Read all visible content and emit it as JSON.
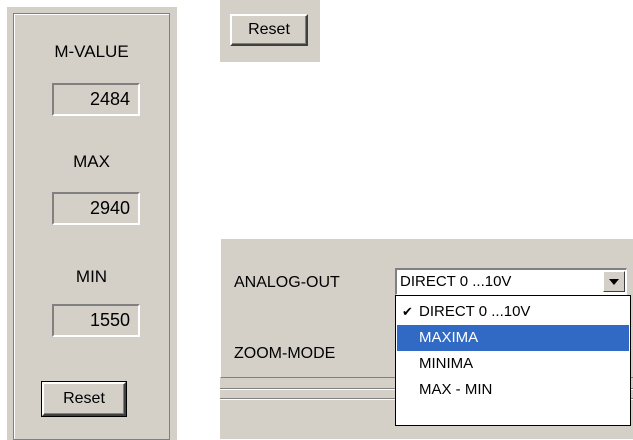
{
  "left_panel": {
    "mvalue_label": "M-VALUE",
    "mvalue": "2484",
    "max_label": "MAX",
    "max_value": "2940",
    "min_label": "MIN",
    "min_value": "1550",
    "reset_label": "Reset"
  },
  "top_panel": {
    "reset_label": "Reset"
  },
  "settings": {
    "analog_out_label": "ANALOG-OUT",
    "analog_out_value": "DIRECT 0 ...10V",
    "zoom_mode_label": "ZOOM-MODE"
  },
  "dropdown": {
    "options": [
      {
        "label": "DIRECT 0 ...10V",
        "checked": true
      },
      {
        "label": "MAXIMA",
        "highlighted": true
      },
      {
        "label": "MINIMA"
      },
      {
        "label": "MAX - MIN"
      }
    ],
    "check_mark": "✔"
  },
  "colors": {
    "panel": "#d4d0c8",
    "highlight": "#316ac5"
  }
}
